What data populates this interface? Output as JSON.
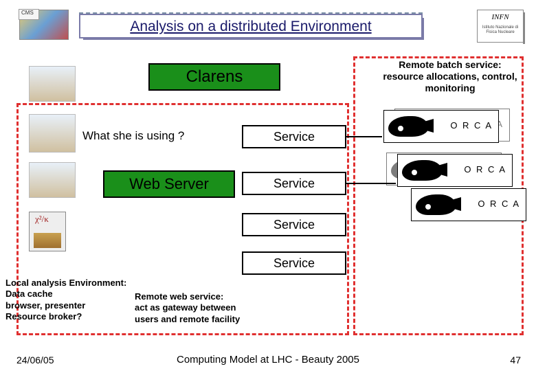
{
  "header": {
    "title": "Analysis on a distributed Environment",
    "left_logo_label": "CMS",
    "right_logo_label": "INFN",
    "right_logo_sub": "Istituto Nazionale\ndi Fisica Nucleare"
  },
  "boxes": {
    "clarens": "Clarens",
    "web_server": "Web Server",
    "services": [
      "Service",
      "Service",
      "Service",
      "Service"
    ]
  },
  "labels": {
    "remote_batch": "Remote batch service: resource allocations, control, monitoring",
    "what_using": "What she is using ?",
    "local_env": "Local analysis Environment:\nData cache\nbrowser, presenter\nResource broker?",
    "remote_web": "Remote web service:\n act as gateway between\nusers and remote facility"
  },
  "orca": {
    "label": "O R C A"
  },
  "clipart_chi": "χ²/κ",
  "footer": {
    "date": "24/06/05",
    "center": "Computing Model at LHC - Beauty 2005",
    "page": "47"
  }
}
